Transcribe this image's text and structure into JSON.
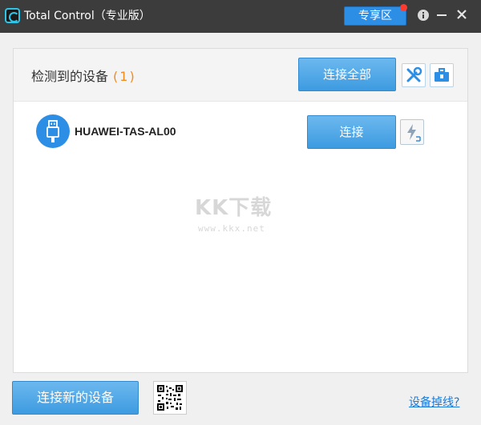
{
  "window": {
    "title": "Total Control（专业版）",
    "vip_label": "专享区"
  },
  "devices_panel": {
    "title": "检测到的设备",
    "count": "(1)",
    "connect_all_label": "连接全部"
  },
  "devices": [
    {
      "name": "HUAWEI-TAS-AL00",
      "connect_label": "连接"
    }
  ],
  "watermark": {
    "logo": "KK下载",
    "url": "www.kkx.net"
  },
  "footer": {
    "new_device_label": "连接新的设备",
    "offline_link": "设备掉线?"
  },
  "colors": {
    "titlebar": "#3c3c3c",
    "accent": "#2d8ee6",
    "count": "#f08c1e",
    "link": "#1c78d6",
    "notification_dot": "#ff3b2f"
  }
}
